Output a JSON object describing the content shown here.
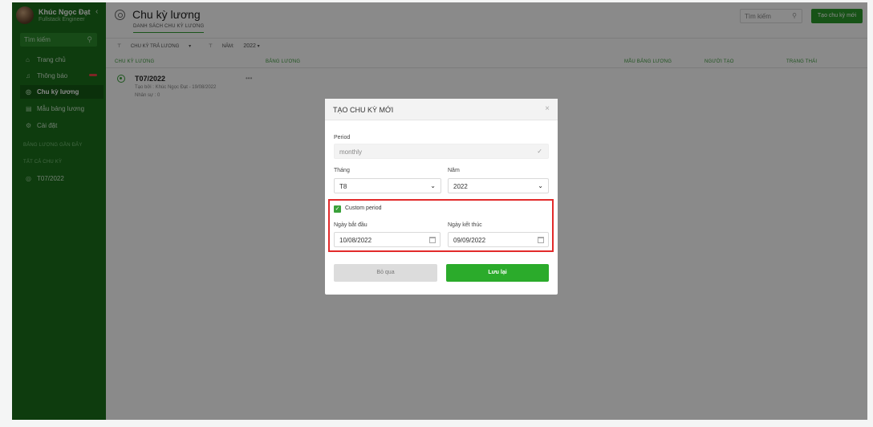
{
  "sidebar": {
    "user_name": "Khúc Ngọc Đạt",
    "user_role": "Fullstack Engineer",
    "collapse_glyph": "‹",
    "search_placeholder": "Tìm kiếm",
    "items": [
      {
        "label": "Trang chủ",
        "icon": "home-icon"
      },
      {
        "label": "Thông báo",
        "icon": "bell-icon"
      },
      {
        "label": "Chu kỳ lương",
        "icon": "cycle-icon"
      },
      {
        "label": "Mẫu bảng lương",
        "icon": "template-icon"
      },
      {
        "label": "Cài đặt",
        "icon": "gear-icon"
      }
    ],
    "section_payroll": "BẢNG LƯƠNG GẦN ĐÂY",
    "section_all": "TẤT CẢ CHU KỲ",
    "cycle_item": "T07/2022"
  },
  "header": {
    "title": "Chu kỳ lương",
    "subtab": "DANH SÁCH CHU KỲ LƯƠNG",
    "search_placeholder": "Tìm kiếm",
    "create_button": "Tạo chu kỳ mới"
  },
  "filters": {
    "cycle_label": "CHU KỲ TRẢ LƯƠNG",
    "year_label": "NĂM:",
    "year_value": "2022"
  },
  "table": {
    "columns": [
      "CHU KỲ LƯƠNG",
      "BẢNG LƯƠNG",
      "MẪU BẢNG LƯƠNG",
      "NGƯỜI TẠO",
      "TRẠNG THÁI"
    ],
    "row": {
      "title": "T07/2022",
      "created": "Tạo bởi : Khúc Ngọc Đạt - 19/08/2022",
      "count": "Nhân sự : 0",
      "more": "•••"
    }
  },
  "modal": {
    "title": "TẠO CHU KỲ MỚI",
    "close": "×",
    "period_label": "Period",
    "period_value": "monthly",
    "month_label": "Tháng",
    "month_value": "T8",
    "year_label": "Năm",
    "year_value": "2022",
    "custom_period_label": "Custom period",
    "custom_period_checked": true,
    "start_label": "Ngày bắt đầu",
    "start_value": "10/08/2022",
    "end_label": "Ngày kết thúc",
    "end_value": "09/09/2022",
    "cancel_button": "Bỏ qua",
    "save_button": "Lưu lại"
  },
  "colors": {
    "sidebar": "#1b6f1b",
    "accent": "#2bab2b",
    "highlight": "#e22b2b"
  }
}
